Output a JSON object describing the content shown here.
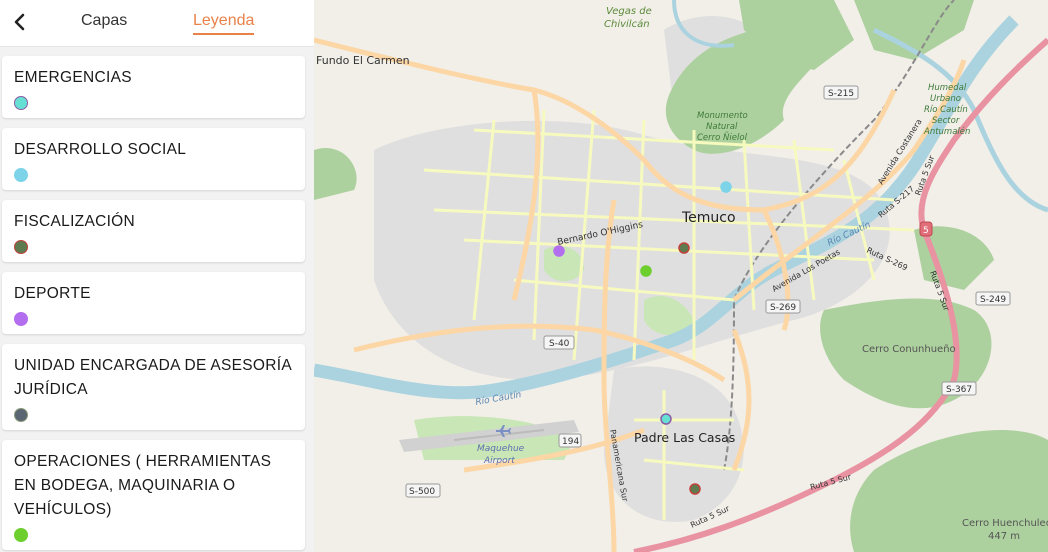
{
  "panel": {
    "back_icon": "chevron-left-icon",
    "tabs": [
      {
        "label": "Capas",
        "active": false
      },
      {
        "label": "Leyenda",
        "active": true
      }
    ],
    "accent": "#e8824a"
  },
  "legend": [
    {
      "label": "EMERGENCIAS",
      "color": "#67e0d4",
      "outline": "#8a5aa6"
    },
    {
      "label": "DESARROLLO SOCIAL",
      "color": "#7dd3e8",
      "outline": "#7dd3e8"
    },
    {
      "label": "FISCALIZACIÓN",
      "color": "#5e7a4f",
      "outline": "#c2413b"
    },
    {
      "label": "DEPORTE",
      "color": "#b36ef0",
      "outline": "#b36ef0"
    },
    {
      "label": "UNIDAD ENCARGADA DE ASESORÍA JURÍDICA",
      "color": "#5a6672",
      "outline": "#8a9a7a"
    },
    {
      "label": "OPERACIONES ( HERRAMIENTAS EN BODEGA, MAQUINARIA O VEHÍCULOS)",
      "color": "#6ccf2d",
      "outline": "#6ccf2d"
    }
  ],
  "map": {
    "labels": {
      "fundo": "Fundo El Carmen",
      "vegas1": "Vegas de",
      "vegas2": "Chivilcán",
      "monumento1": "Monumento",
      "monumento2": "Natural",
      "monumento3": "Cerro Ñielol",
      "humedal1": "Humedal",
      "humedal2": "Urbano",
      "humedal3": "Río Cautín",
      "humedal4": "Sector",
      "humedal5": "Antumalén",
      "temuco": "Temuco",
      "ohiggins": "Bernardo O'Higgins",
      "costanera": "Avenida Costanera",
      "alemania": "Avenida Los Poetas",
      "rio_cautin_e": "Río Cautín",
      "rio_cautin_w": "Río Cautín",
      "padre": "Padre Las Casas",
      "maquehue1": "Maquehue",
      "maquehue2": "Airport",
      "conunhueno": "Cerro Conunhueño",
      "huenchuleo1": "Cerro Huenchuleo",
      "huenchuleo2": "447 m",
      "panamericana": "Panamericana Sur",
      "ruta5a": "Ruta 5 Sur",
      "ruta5b": "Ruta 5 Sur",
      "ruta5c": "Ruta 5 Sur",
      "ruta5d": "Ruta 5 Sur",
      "ruta_s269": "Ruta S-269",
      "ruta_s217": "Ruta S-217"
    },
    "shields": {
      "s215": "S-215",
      "s269": "S-269",
      "s249": "S-249",
      "s40": "S-40",
      "s367": "S-367",
      "r194": "194",
      "s500": "S-500",
      "r5": "5"
    },
    "markers": [
      {
        "category": "DESARROLLO SOCIAL",
        "color": "#7dd3e8",
        "outline": "#7dd3e8"
      },
      {
        "category": "FISCALIZACIÓN",
        "color": "#5e7a4f",
        "outline": "#c2413b"
      },
      {
        "category": "DEPORTE",
        "color": "#b36ef0",
        "outline": "#b36ef0"
      },
      {
        "category": "OPERACIONES",
        "color": "#6ccf2d",
        "outline": "#6ccf2d"
      },
      {
        "category": "EMERGENCIAS",
        "color": "#67e0d4",
        "outline": "#8a5aa6"
      },
      {
        "category": "FISCALIZACIÓN",
        "color": "#5e7a4f",
        "outline": "#c2413b"
      }
    ]
  }
}
